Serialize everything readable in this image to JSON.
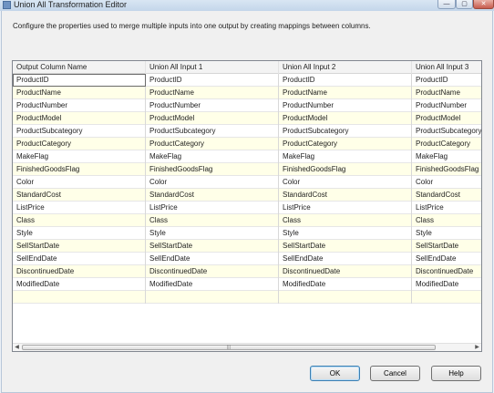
{
  "window": {
    "title": "Union All Transformation Editor",
    "min_label": "—",
    "max_label": "▢",
    "close_label": "✕"
  },
  "description": "Configure the properties used to merge multiple inputs into one output by creating mappings between columns.",
  "grid": {
    "headers": [
      "Output Column Name",
      "Union All Input 1",
      "Union All Input 2",
      "Union All Input 3"
    ],
    "rows": [
      [
        "ProductID",
        "ProductID",
        "ProductID",
        "ProductID"
      ],
      [
        "ProductName",
        "ProductName",
        "ProductName",
        "ProductName"
      ],
      [
        "ProductNumber",
        "ProductNumber",
        "ProductNumber",
        "ProductNumber"
      ],
      [
        "ProductModel",
        "ProductModel",
        "ProductModel",
        "ProductModel"
      ],
      [
        "ProductSubcategory",
        "ProductSubcategory",
        "ProductSubcategory",
        "ProductSubcategory"
      ],
      [
        "ProductCategory",
        "ProductCategory",
        "ProductCategory",
        "ProductCategory"
      ],
      [
        "MakeFlag",
        "MakeFlag",
        "MakeFlag",
        "MakeFlag"
      ],
      [
        "FinishedGoodsFlag",
        "FinishedGoodsFlag",
        "FinishedGoodsFlag",
        "FinishedGoodsFlag"
      ],
      [
        "Color",
        "Color",
        "Color",
        "Color"
      ],
      [
        "StandardCost",
        "StandardCost",
        "StandardCost",
        "StandardCost"
      ],
      [
        "ListPrice",
        "ListPrice",
        "ListPrice",
        "ListPrice"
      ],
      [
        "Class",
        "Class",
        "Class",
        "Class"
      ],
      [
        "Style",
        "Style",
        "Style",
        "Style"
      ],
      [
        "SellStartDate",
        "SellStartDate",
        "SellStartDate",
        "SellStartDate"
      ],
      [
        "SellEndDate",
        "SellEndDate",
        "SellEndDate",
        "SellEndDate"
      ],
      [
        "DiscontinuedDate",
        "DiscontinuedDate",
        "DiscontinuedDate",
        "DiscontinuedDate"
      ],
      [
        "ModifiedDate",
        "ModifiedDate",
        "ModifiedDate",
        "ModifiedDate"
      ],
      [
        "",
        "",
        "",
        ""
      ]
    ]
  },
  "buttons": {
    "ok": "OK",
    "cancel": "Cancel",
    "help": "Help"
  }
}
